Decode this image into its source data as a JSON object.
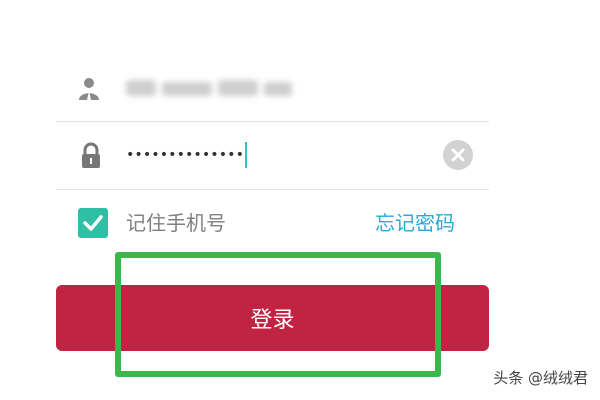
{
  "login_form": {
    "username": {
      "icon": "user-icon",
      "value_obscured": true
    },
    "password": {
      "icon": "lock-icon",
      "value": "••••••••••••••",
      "clear_icon": "clear-icon"
    },
    "remember": {
      "checked": true,
      "label": "记住手机号",
      "check_color": "#2ebfa5"
    },
    "forgot_password": "忘记密码",
    "forgot_color": "#2aa7d9",
    "submit_label": "登录",
    "submit_color": "#c12443"
  },
  "annotation": {
    "highlight_color": "#3cb84a"
  },
  "watermark": "头条 @绒绒君"
}
